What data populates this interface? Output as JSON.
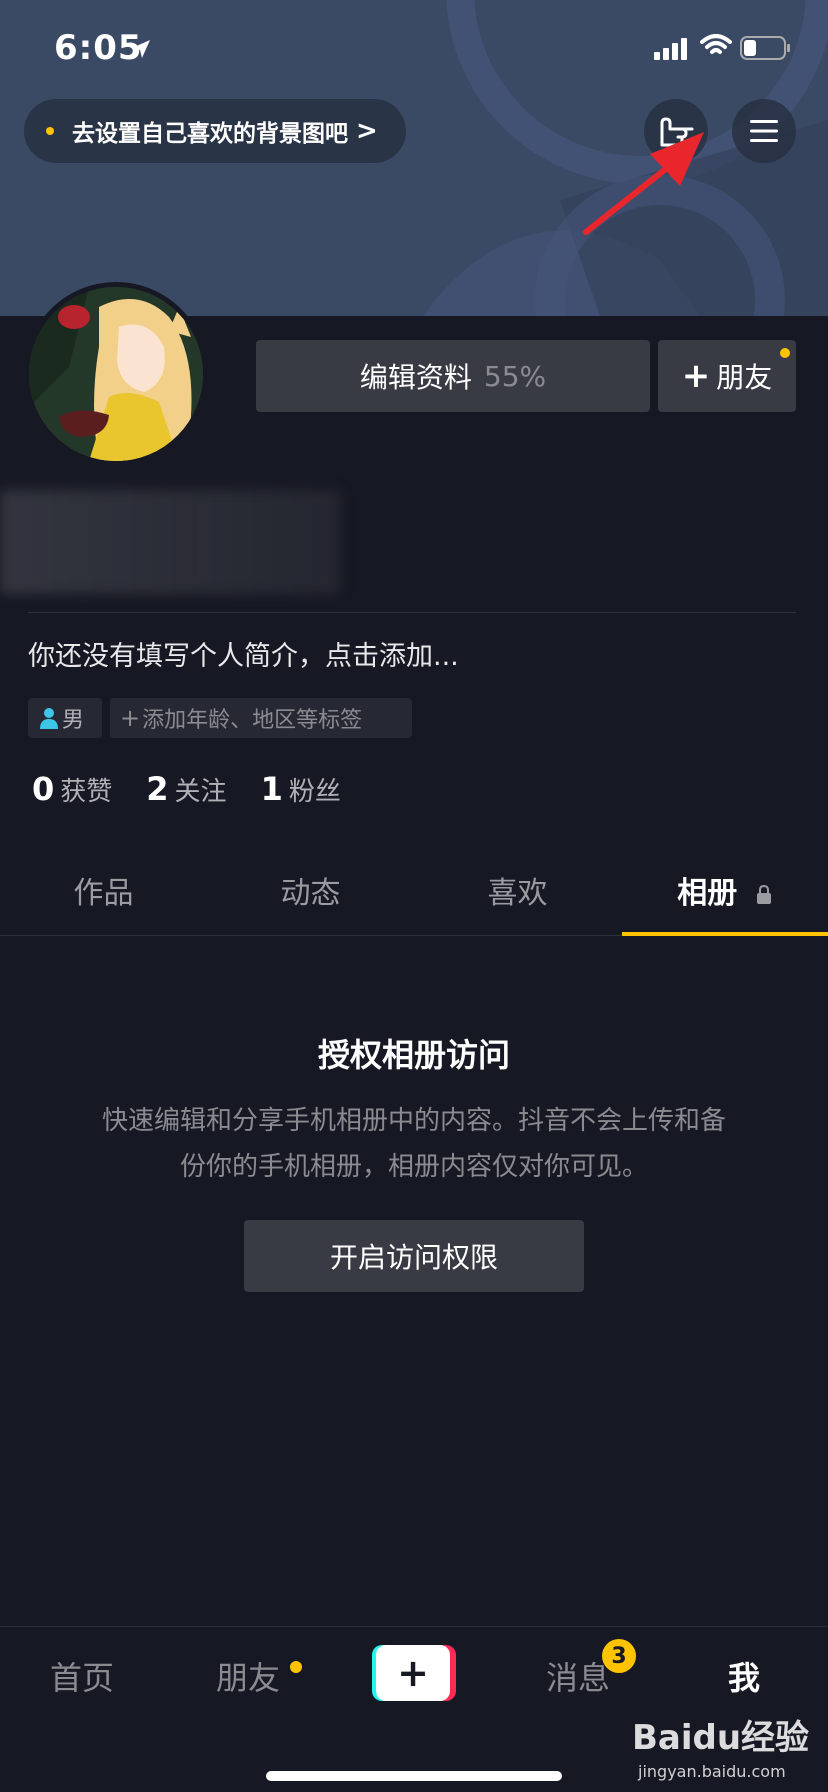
{
  "status_bar": {
    "time": "6:05"
  },
  "header": {
    "bg_hint": "去设置自己喜欢的背景图吧",
    "bg_hint_chevron": ">"
  },
  "profile": {
    "edit_label": "编辑资料",
    "edit_percent": "55%",
    "friend_label": "朋友",
    "bio": "你还没有填写个人简介，点击添加...",
    "gender_tag": "男",
    "add_tag": "添加年龄、地区等标签",
    "stats": [
      {
        "num": "0",
        "label": "获赞"
      },
      {
        "num": "2",
        "label": "关注"
      },
      {
        "num": "1",
        "label": "粉丝"
      }
    ]
  },
  "tabs": [
    {
      "label": "作品"
    },
    {
      "label": "动态"
    },
    {
      "label": "喜欢"
    },
    {
      "label": "相册"
    }
  ],
  "album_auth": {
    "title": "授权相册访问",
    "desc_line1": "快速编辑和分享手机相册中的内容。抖音不会上传和备",
    "desc_line2": "份你的手机相册，相册内容仅对你可见。",
    "button": "开启访问权限"
  },
  "bottom_nav": {
    "home": "首页",
    "friends": "朋友",
    "plus": "+",
    "messages": "消息",
    "messages_badge": "3",
    "me": "我"
  },
  "watermark": {
    "main": "Baidu经验",
    "sub": "jingyan.baidu.com"
  },
  "colors": {
    "background": "#161823",
    "accent": "#ffc300",
    "button": "#393b44",
    "header": "#3b4a64"
  }
}
